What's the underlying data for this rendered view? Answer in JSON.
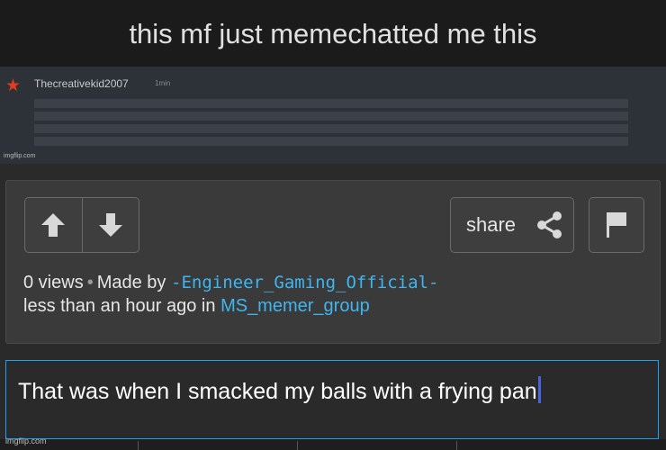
{
  "caption": "this mf just memechatted me this",
  "chat": {
    "username": "Thecreativekid2007",
    "time": "1min",
    "watermark": "imgflip.com"
  },
  "panel": {
    "share_label": "share",
    "views": "0 views",
    "made_by_prefix": "Made by",
    "author": "-Engineer_Gaming_Official-",
    "time_prefix": "less than an hour ago in",
    "group": "MS_memer_group"
  },
  "comment_input": {
    "value": "That was when I smacked my balls with a frying pan"
  },
  "footer": {
    "watermark": "imgflip.com"
  },
  "colors": {
    "link": "#3fb6f0",
    "focus_border": "#1da1f2"
  }
}
